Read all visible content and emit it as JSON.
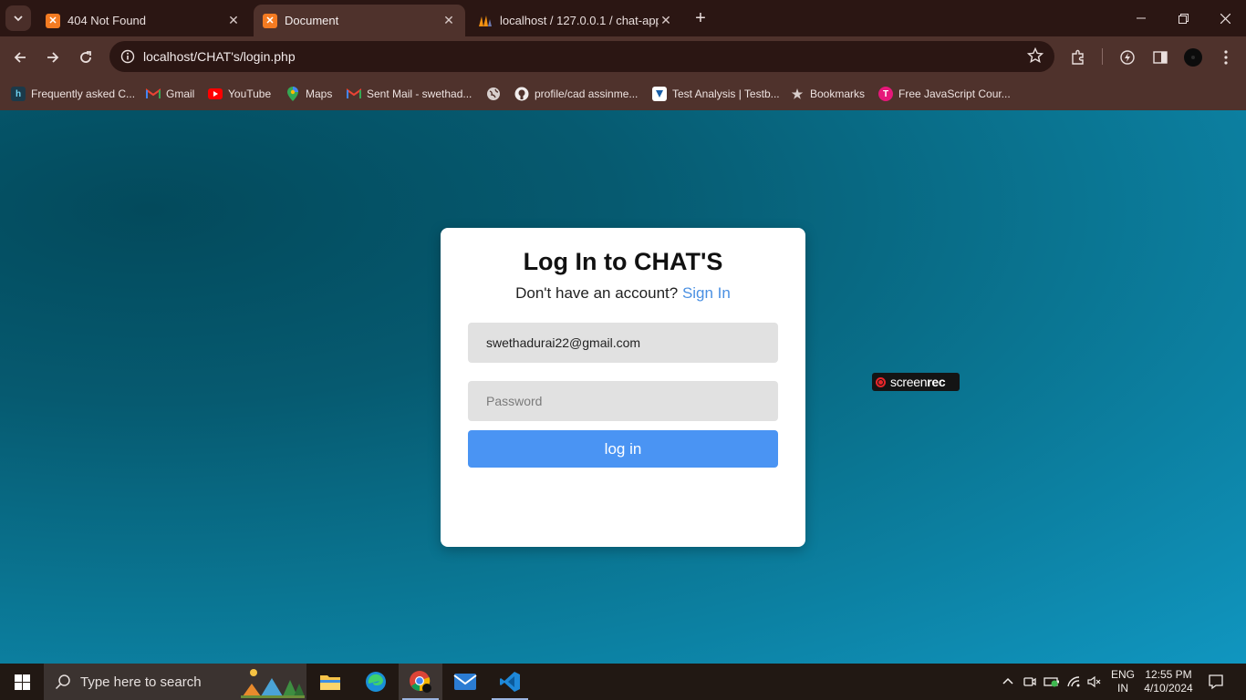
{
  "browser": {
    "tabs": [
      {
        "title": "404 Not Found",
        "active": false
      },
      {
        "title": "Document",
        "active": true
      },
      {
        "title": "localhost / 127.0.0.1 / chat-app",
        "active": false
      }
    ],
    "url": "localhost/CHAT's/login.php",
    "bookmarks": [
      {
        "label": "Frequently asked C...",
        "icon": "helpdesk-icon"
      },
      {
        "label": "Gmail",
        "icon": "gmail-icon"
      },
      {
        "label": "YouTube",
        "icon": "youtube-icon"
      },
      {
        "label": "Maps",
        "icon": "maps-icon"
      },
      {
        "label": "Sent Mail - swethad...",
        "icon": "gmail-icon"
      },
      {
        "label": "",
        "icon": "globe-icon"
      },
      {
        "label": "profile/cad assinme...",
        "icon": "github-icon"
      },
      {
        "label": "Test Analysis | Testb...",
        "icon": "testbook-icon"
      },
      {
        "label": "Bookmarks",
        "icon": "star-icon"
      },
      {
        "label": "Free JavaScript Cour...",
        "icon": "course-icon"
      }
    ]
  },
  "login": {
    "title": "Log In to CHAT'S",
    "subtitle": "Don't have an account?",
    "signin_link": "Sign In",
    "email_value": "swethadurai22@gmail.com",
    "password_placeholder": "Password",
    "button_label": "log in"
  },
  "overlay": {
    "brand_light": "screen",
    "brand_bold": "rec"
  },
  "taskbar": {
    "search_placeholder": "Type here to search",
    "language": "ENG",
    "region": "IN",
    "time": "12:55 PM",
    "date": "4/10/2024"
  },
  "colors": {
    "accent": "#4a94f3",
    "link": "#4a90e2",
    "chrome_frame": "#2b1613",
    "chrome_toolbar": "#4f322c"
  }
}
